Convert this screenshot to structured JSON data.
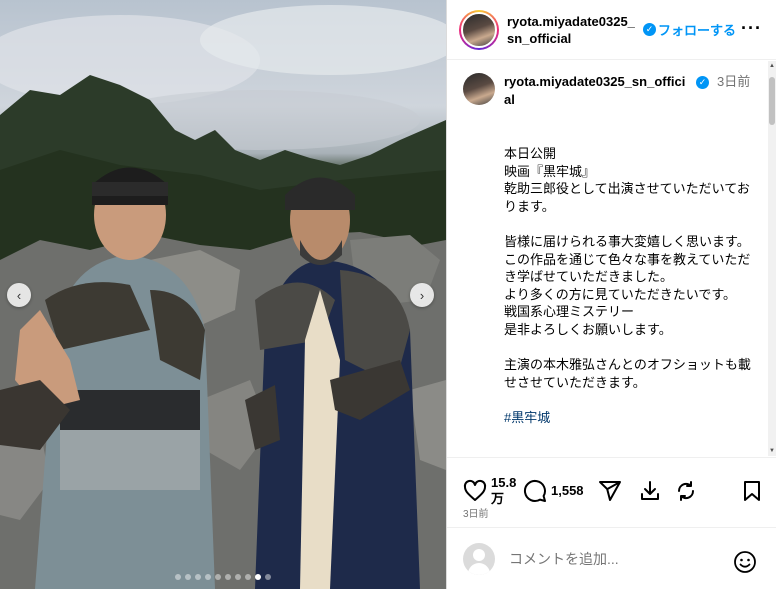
{
  "header": {
    "username": "ryota.miyadate0325_sn_official",
    "follow_label": "フォローする",
    "verified_mark": "✓",
    "more_label": "···"
  },
  "caption": {
    "username": "ryota.miyadate0325_sn_official",
    "time_ago": "3日前",
    "text": "本日公開\n映画『黒牢城』\n乾助三郎役として出演させていただいております。\n\n皆様に届けられる事大変嬉しく思います。\nこの作品を通じて色々な事を教えていただき学ばせていただきました。\nより多くの方に見ていただきたいです。\n戦国系心理ミステリー\n是非よろしくお願いします。\n\n主演の本木雅弘さんとのオフショットも載せさせていただきます。",
    "hashtag": "#黒牢城"
  },
  "actions": {
    "likes": "15.8万",
    "comments": "1,558",
    "posted": "3日前"
  },
  "comment_box": {
    "placeholder": "コメントを追加..."
  },
  "carousel": {
    "prev": "‹",
    "next": "›",
    "slide_count": 10,
    "active_index": 8
  },
  "scrollbar": {
    "up": "▲",
    "down": "▼"
  },
  "colors": {
    "accent": "#0095f6",
    "hashtag": "#00376b",
    "muted": "#737373"
  },
  "icons": [
    "heart-icon",
    "comment-icon",
    "share-icon",
    "download-icon",
    "repost-icon",
    "bookmark-icon",
    "emoji-icon"
  ]
}
